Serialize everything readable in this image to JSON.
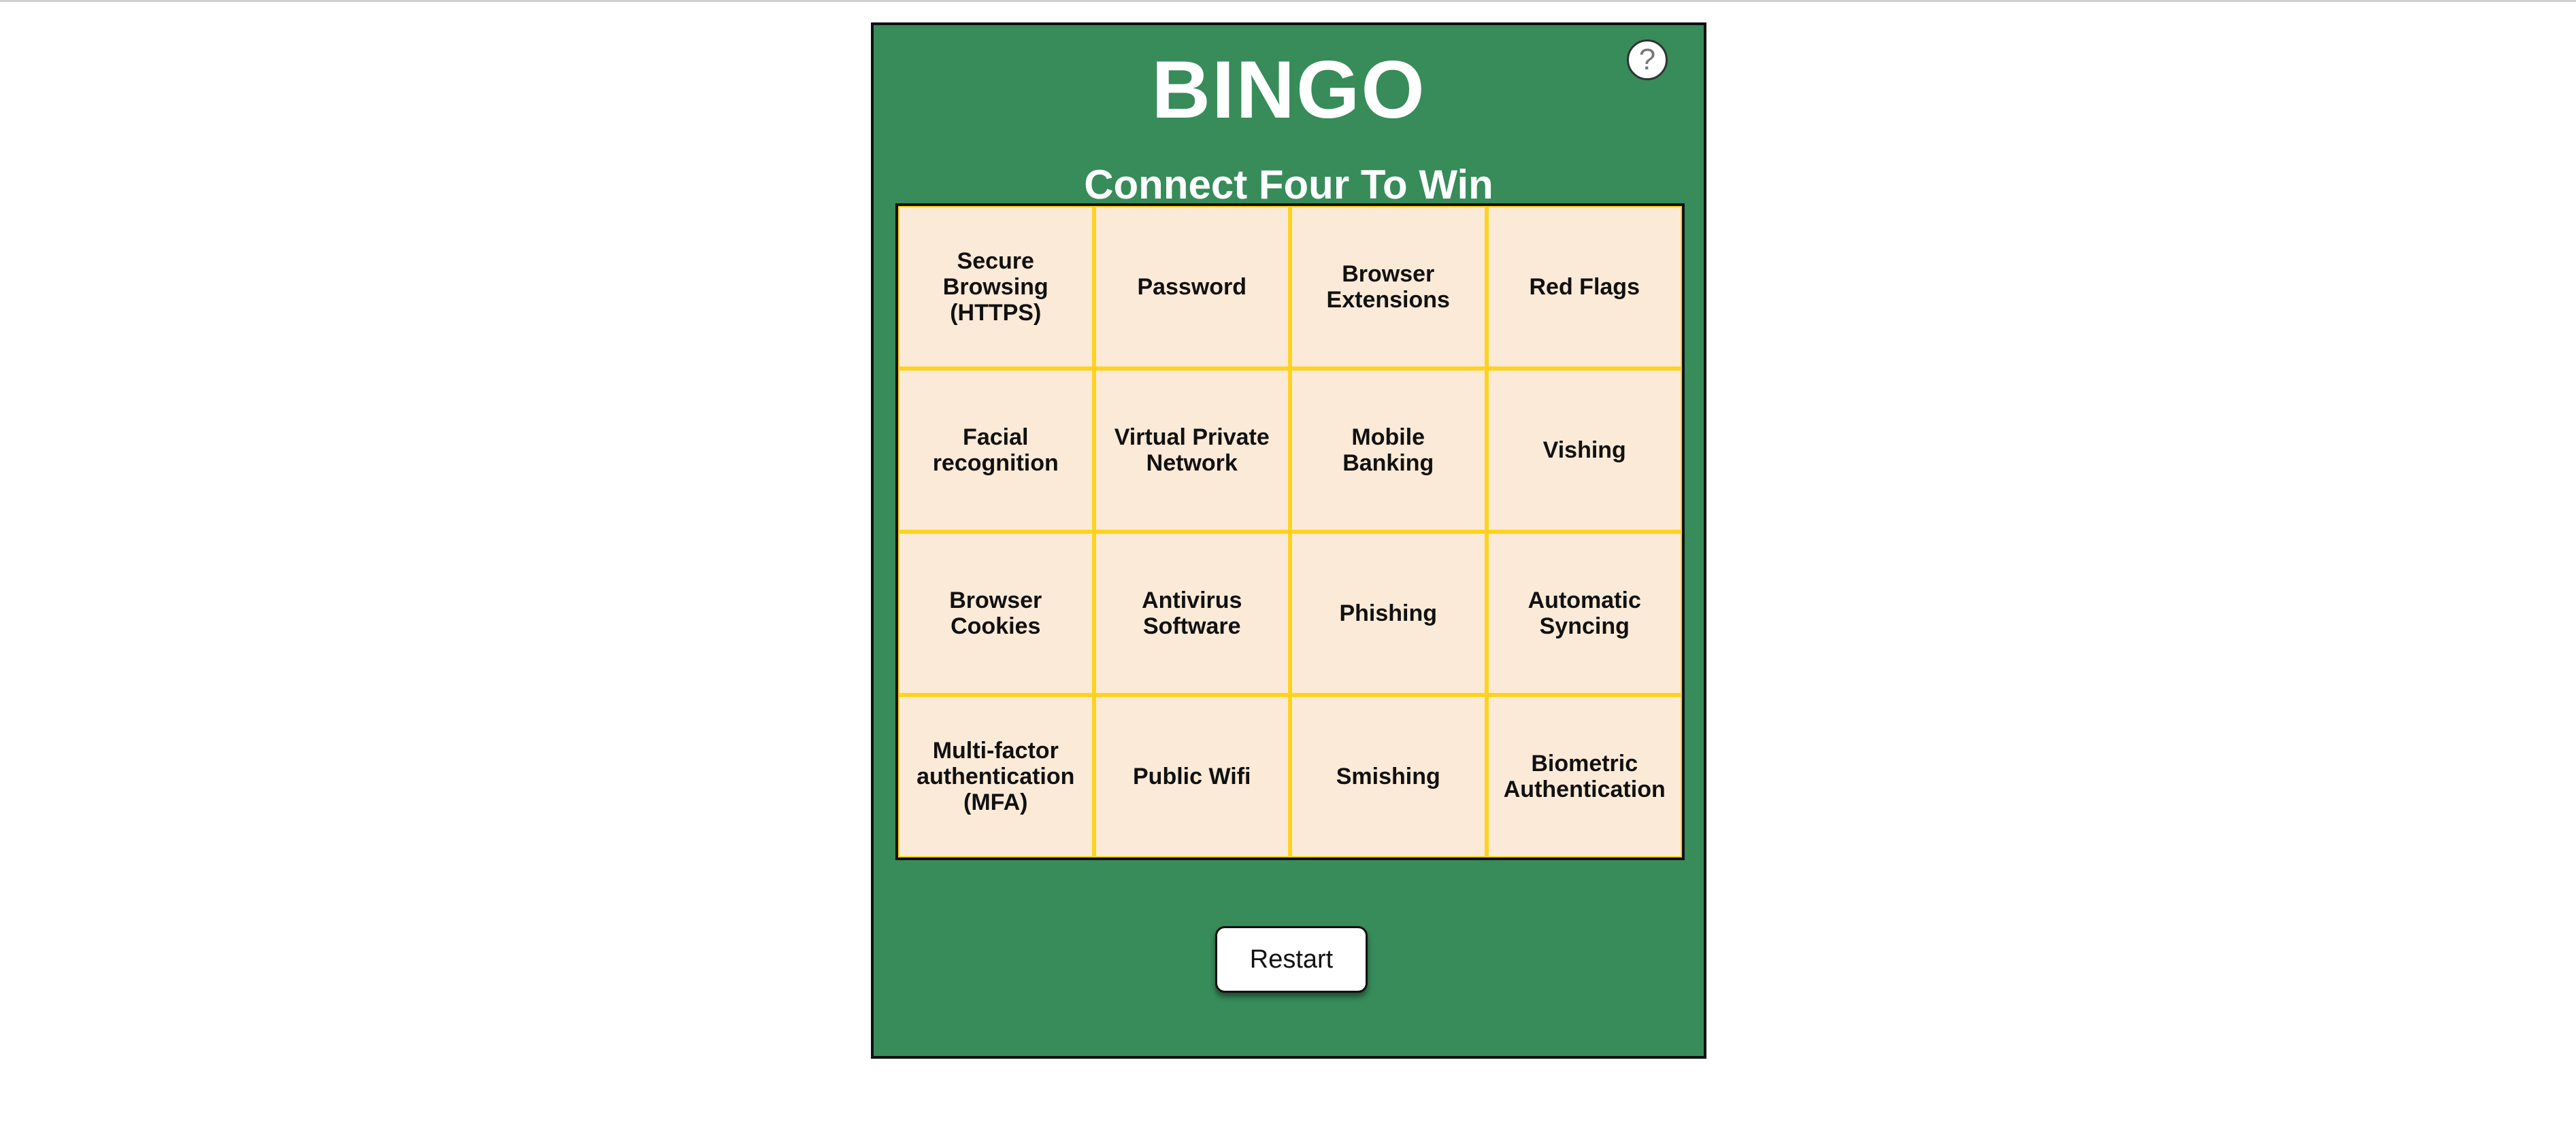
{
  "game": {
    "title": "BINGO",
    "subtitle": "Connect Four To Win",
    "help_label": "?",
    "restart_label": "Restart",
    "colors": {
      "board": "#378c5a",
      "cell": "#fbead7",
      "grid_lines": "#ffd21f"
    }
  },
  "cells": [
    {
      "label": "Secure Browsing (HTTPS)"
    },
    {
      "label": "Password"
    },
    {
      "label": "Browser Extensions"
    },
    {
      "label": "Red Flags"
    },
    {
      "label": "Facial recognition"
    },
    {
      "label": "Virtual Private Network"
    },
    {
      "label": "Mobile Banking"
    },
    {
      "label": "Vishing"
    },
    {
      "label": "Browser Cookies"
    },
    {
      "label": "Antivirus Software"
    },
    {
      "label": "Phishing"
    },
    {
      "label": "Automatic Syncing"
    },
    {
      "label": "Multi-factor authentication (MFA)"
    },
    {
      "label": "Public Wifi"
    },
    {
      "label": "Smishing"
    },
    {
      "label": "Biometric Authentication"
    }
  ]
}
